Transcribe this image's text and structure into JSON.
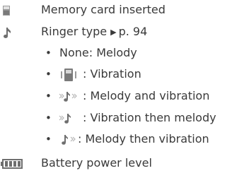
{
  "rows": [
    {
      "icon": "memory-card-icon",
      "text": "Memory card inserted"
    },
    {
      "icon": "ringer-note-icon",
      "text": "Ringer type",
      "arrow": "▶",
      "page_ref": "p. 94"
    },
    {
      "text": "None: Melody"
    },
    {
      "icon": "vibration-phone-icon",
      "text": ": Vibration"
    },
    {
      "icon": "melody-and-vibration-icon",
      "text": ": Melody and vibration"
    },
    {
      "icon": "vibration-then-melody-icon",
      "text": ": Vibration then melody"
    },
    {
      "icon": "melody-then-vibration-icon",
      "text": ": Melody then vibration"
    },
    {
      "icon": "battery-icon",
      "text": "Battery power level"
    }
  ],
  "bullet_symbol": "•",
  "colors": {
    "text": "#3a3a3a",
    "icon_gray": "#6e6e6e",
    "icon_light": "#b5b5b5"
  }
}
